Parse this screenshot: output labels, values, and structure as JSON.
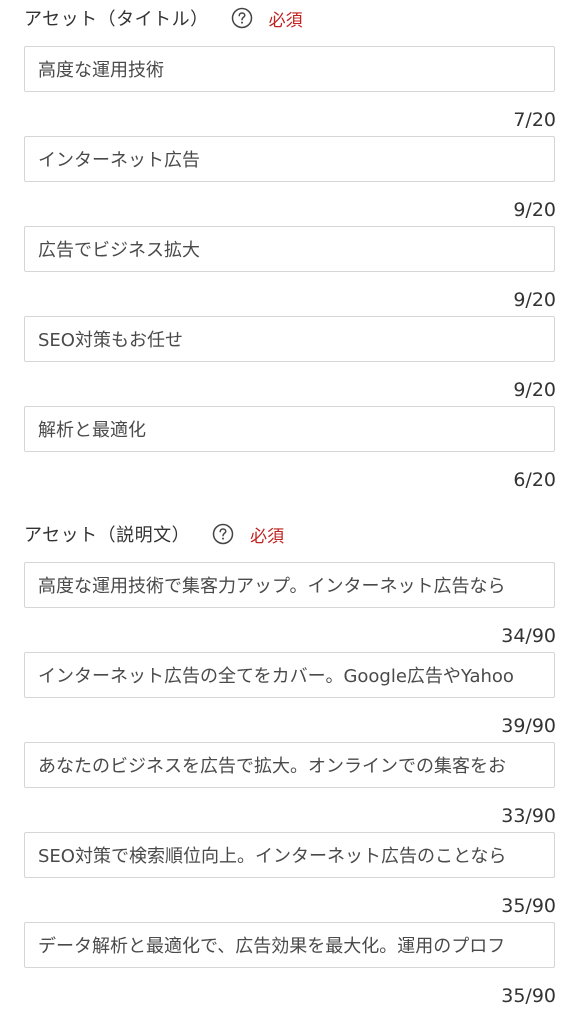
{
  "titles_section": {
    "label": "アセット（タイトル）",
    "required_label": "必須",
    "help_icon": "question-circle-icon",
    "fields": [
      {
        "value": "高度な運用技術",
        "counter": "7/20"
      },
      {
        "value": "インターネット広告",
        "counter": "9/20"
      },
      {
        "value": "広告でビジネス拡大",
        "counter": "9/20"
      },
      {
        "value": "SEO対策もお任せ",
        "counter": "9/20"
      },
      {
        "value": "解析と最適化",
        "counter": "6/20"
      }
    ]
  },
  "descriptions_section": {
    "label": "アセット（説明文）",
    "required_label": "必須",
    "help_icon": "question-circle-icon",
    "fields": [
      {
        "value": "高度な運用技術で集客力アップ。インターネット広告なら",
        "counter": "34/90"
      },
      {
        "value": "インターネット広告の全てをカバー。Google広告やYahoo",
        "counter": "39/90"
      },
      {
        "value": "あなたのビジネスを広告で拡大。オンラインでの集客をお",
        "counter": "33/90"
      },
      {
        "value": "SEO対策で検索順位向上。インターネット広告のことなら",
        "counter": "35/90"
      },
      {
        "value": "データ解析と最適化で、広告効果を最大化。運用のプロフ",
        "counter": "35/90"
      }
    ]
  },
  "colors": {
    "required": "#c0221f",
    "border": "#d6d6d6",
    "text": "#333333"
  }
}
